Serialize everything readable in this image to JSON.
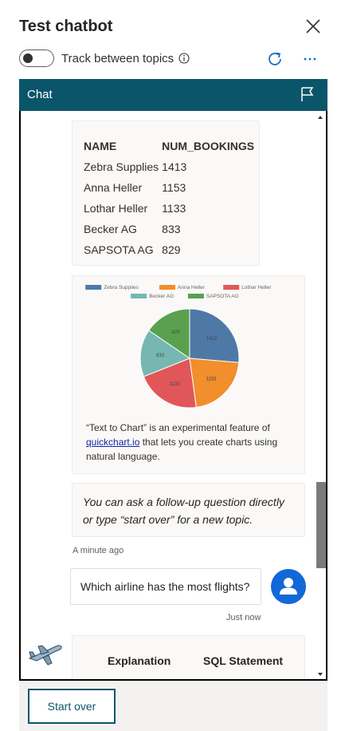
{
  "header": {
    "title": "Test chatbot"
  },
  "toggle": {
    "label": "Track between topics",
    "on": false
  },
  "chat": {
    "title": "Chat"
  },
  "table": {
    "columns": [
      "NAME",
      "NUM_BOOKINGS"
    ],
    "rows": [
      [
        "Zebra Supplies",
        "1413"
      ],
      [
        "Anna Heller",
        "1153"
      ],
      [
        "Lothar Heller",
        "1133"
      ],
      [
        "Becker AG",
        "833"
      ],
      [
        "SAPSOTA AG",
        "829"
      ]
    ]
  },
  "chart_data": {
    "type": "pie",
    "categories": [
      "Zebra Supplies",
      "Anna Heller",
      "Lothar Heller",
      "Becker AG",
      "SAPSOTA AG"
    ],
    "values": [
      1413,
      1153,
      1133,
      833,
      829
    ],
    "colors": [
      "#4e79a7",
      "#f28e2b",
      "#e15759",
      "#76b7b2",
      "#59a14f"
    ],
    "data_labels": [
      "1413",
      "1153",
      "1133",
      "833",
      "829"
    ],
    "legend_position": "top"
  },
  "chart_caption": {
    "before": "“Text to Chart” is an experimental feature of ",
    "link": "quickchart.io",
    "after": " that lets you create charts using natural language."
  },
  "followup": {
    "text": "You can ask a follow-up question directly or type “start over” for a new topic."
  },
  "timestamps": {
    "first": "A minute ago",
    "second": "Just now"
  },
  "user_message": {
    "text": "Which airline has the most flights?"
  },
  "explain": {
    "col1": "Explanation",
    "col2": "SQL Statement"
  },
  "footer": {
    "start_over": "Start over"
  },
  "icons": {
    "close": "close-icon",
    "info": "info-icon",
    "refresh": "refresh-icon",
    "more": "more-icon",
    "flag": "flag-icon",
    "user": "user-icon",
    "bot": "airplane-icon"
  },
  "colors": {
    "accent": "#0b556a",
    "user_avatar": "#1268d8"
  }
}
